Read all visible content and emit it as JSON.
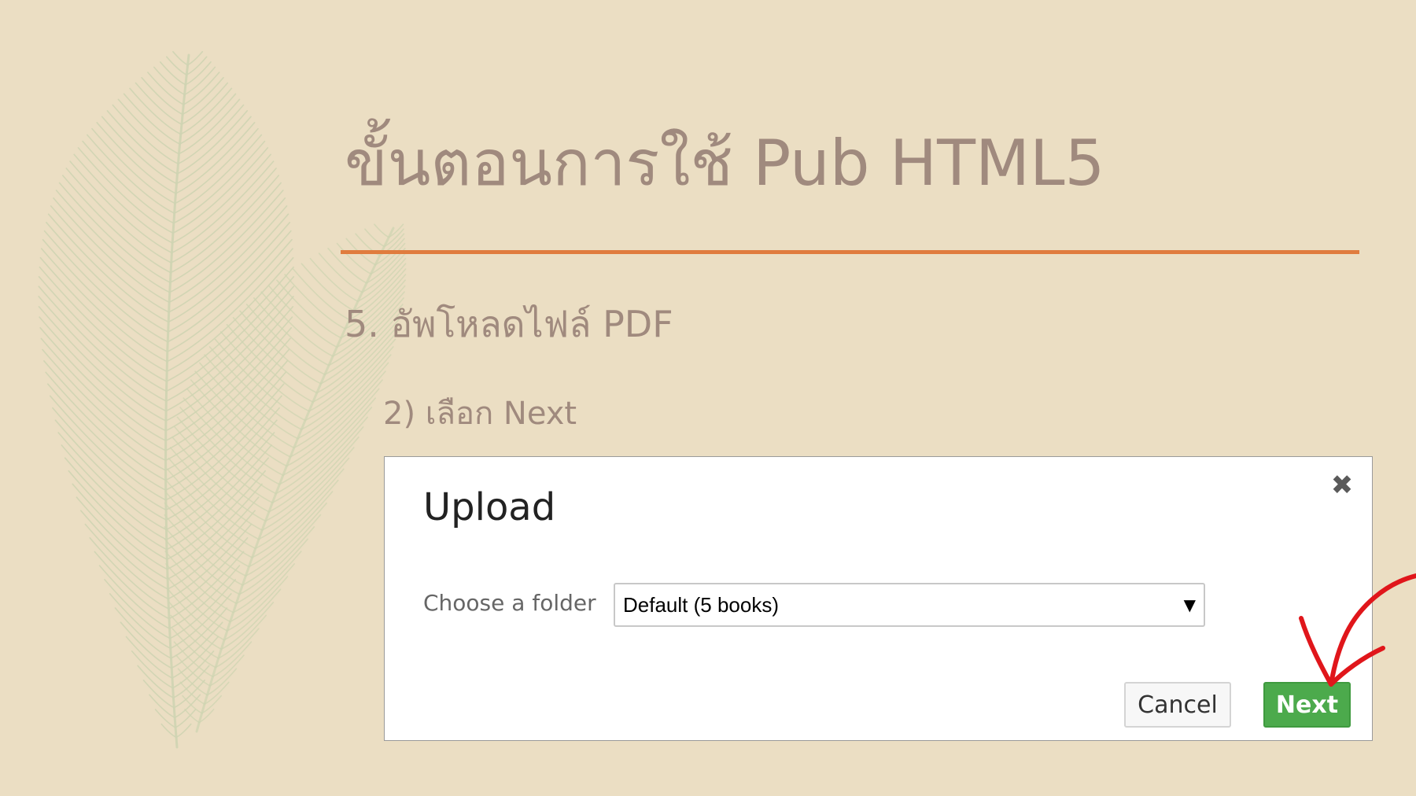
{
  "slide": {
    "title": "ขั้นตอนการใช้ Pub HTML5",
    "subheading": "5. อัพโหลดไฟล์ PDF",
    "substep": "2) เลือก Next",
    "background_color": "#ebdec3",
    "text_color": "#a08a7e",
    "rule_color": "#e07c3e",
    "leaf_color": "#cfd4b2",
    "decorations": [
      "feather-leaf-illustration",
      "red-hand-drawn-arrow"
    ]
  },
  "dialog": {
    "title": "Upload",
    "close_icon": "close-icon",
    "folder_label": "Choose a folder",
    "folder_select": {
      "selected": "Default (5 books)",
      "dropdown_icon": "dropdown-triangle-icon"
    },
    "cancel_label": "Cancel",
    "next_label": "Next",
    "next_color": "#4caa4c",
    "title_color": "#222222",
    "label_color": "#666666",
    "close_color": "#5a5a5a",
    "arrow_color": "#e0161b"
  }
}
